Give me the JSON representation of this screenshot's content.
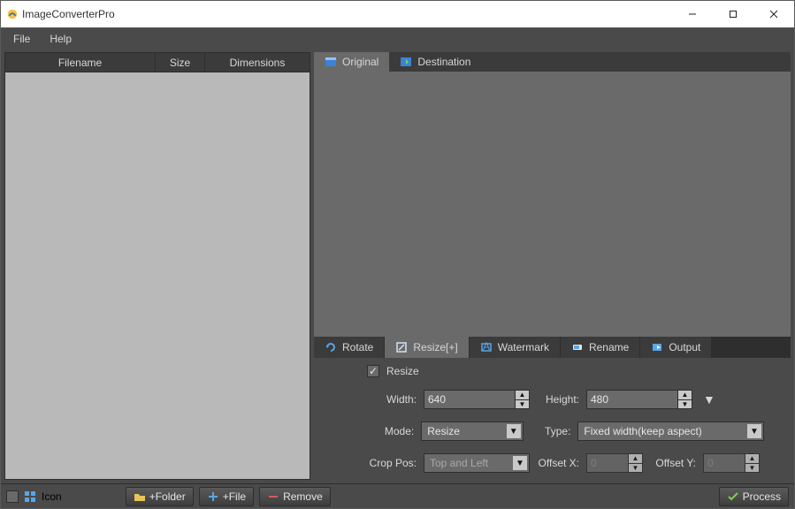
{
  "window": {
    "title": "ImageConverterPro"
  },
  "menubar": {
    "file": "File",
    "help": "Help"
  },
  "filelist": {
    "columns": {
      "filename": "Filename",
      "size": "Size",
      "dimensions": "Dimensions"
    }
  },
  "preview_tabs": {
    "original": "Original",
    "destination": "Destination"
  },
  "op_tabs": {
    "rotate": "Rotate",
    "resize": "Resize[+]",
    "watermark": "Watermark",
    "rename": "Rename",
    "output": "Output"
  },
  "resize_panel": {
    "enable_label": "Resize",
    "enable_checked": true,
    "width_label": "Width:",
    "width_value": "640",
    "height_label": "Height:",
    "height_value": "480",
    "mode_label": "Mode:",
    "mode_value": "Resize",
    "type_label": "Type:",
    "type_value": "Fixed width(keep aspect)",
    "croppos_label": "Crop Pos:",
    "croppos_value": "Top and Left",
    "offsetx_label": "Offset X:",
    "offsetx_value": "0",
    "offsety_label": "Offset Y:",
    "offsety_value": "0"
  },
  "bottombar": {
    "icon_label": "Icon",
    "add_folder": "+Folder",
    "add_file": "+File",
    "remove": "Remove",
    "process": "Process"
  }
}
